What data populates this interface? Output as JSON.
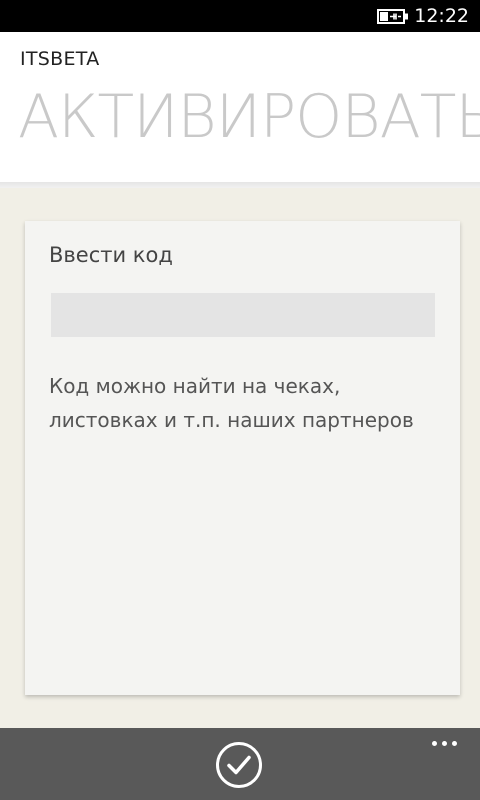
{
  "status_bar": {
    "time": "12:22",
    "battery_icon": "battery-charging-icon"
  },
  "header": {
    "app_name": "ITSBETA",
    "page_title": "АКТИВИРОВАТЬ"
  },
  "card": {
    "title": "Ввести код",
    "input_value": "",
    "input_placeholder": "",
    "hint": "Код можно найти на чеках, листовках и т.п. наших партнеров"
  },
  "app_bar": {
    "confirm_icon": "check-icon",
    "more_icon": "ellipsis-icon"
  }
}
